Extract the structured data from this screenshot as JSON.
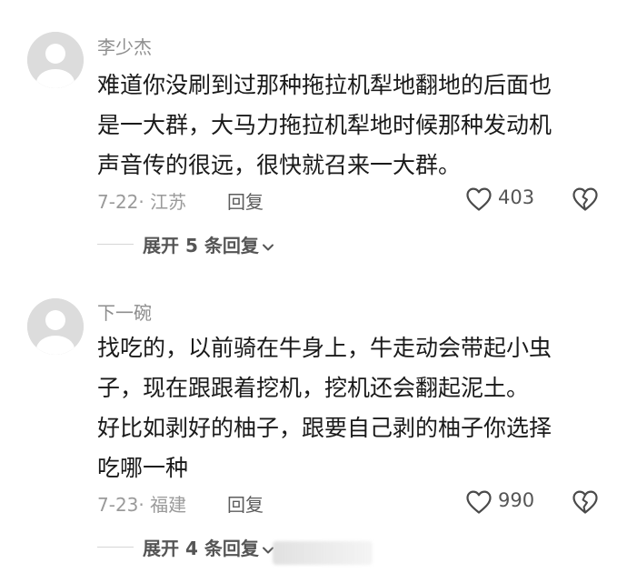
{
  "comments": [
    {
      "username": "李少杰",
      "content_lines": [
        "难道你没刷到过那种拖拉机犁地翻地的后面也",
        "是一大群，大马力拖拉机犁地时候那种发动机",
        "声音传的很远，很快就召来一大群。"
      ],
      "date_location": "7-22· 江苏",
      "reply_label": "回复",
      "like_count": "403",
      "expand_label": "展开 5 条回复"
    },
    {
      "username": "下一碗",
      "content_lines": [
        "找吃的，以前骑在牛身上，牛走动会带起小虫",
        "子，现在跟跟着挖机，挖机还会翻起泥土。",
        "好比如剥好的柚子，跟要自己剥的柚子你选择",
        "吃哪一种"
      ],
      "date_location": "7-23· 福建",
      "reply_label": "回复",
      "like_count": "990",
      "expand_label": "展开 4 条回复"
    }
  ],
  "icons": {
    "avatar": "default-avatar-icon",
    "like": "heart-outline-icon",
    "dislike": "broken-heart-icon",
    "expand": "chevron-down-icon"
  },
  "colors": {
    "username": "#8e8e8e",
    "content": "#1a1a1a",
    "meta": "#9a9a9a",
    "avatar_bg": "#dcdcdc"
  }
}
